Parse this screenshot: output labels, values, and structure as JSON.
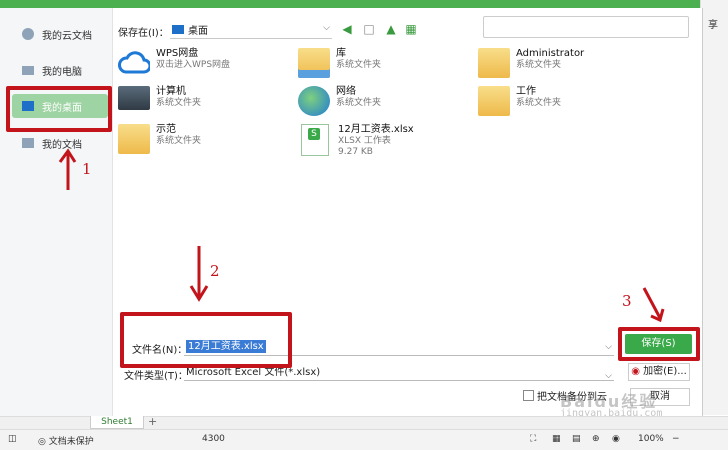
{
  "window": {
    "share_label": "享"
  },
  "sidebar": {
    "items": [
      {
        "label": "我的云文档",
        "icon": "cloud-doc-icon",
        "selected": false
      },
      {
        "label": "我的电脑",
        "icon": "computer-icon",
        "selected": false
      },
      {
        "label": "我的桌面",
        "icon": "desktop-icon",
        "selected": true
      },
      {
        "label": "我的文档",
        "icon": "document-icon",
        "selected": false
      }
    ]
  },
  "toolbar": {
    "save_in_label": "保存在(I)：",
    "location": "桌面",
    "icons": [
      "back-icon",
      "new-folder-icon",
      "up-folder-icon",
      "view-menu-icon"
    ]
  },
  "files": [
    {
      "name": "WPS网盘",
      "desc": "双击进入WPS网盘",
      "size": "",
      "icon": "cloud-icon"
    },
    {
      "name": "库",
      "desc": "系统文件夹",
      "size": "",
      "icon": "library-folder-icon"
    },
    {
      "name": "Administrator",
      "desc": "系统文件夹",
      "size": "",
      "icon": "folder-icon"
    },
    {
      "name": "计算机",
      "desc": "系统文件夹",
      "size": "",
      "icon": "computer-icon"
    },
    {
      "name": "网络",
      "desc": "系统文件夹",
      "size": "",
      "icon": "network-icon"
    },
    {
      "name": "工作",
      "desc": "系统文件夹",
      "size": "",
      "icon": "folder-icon"
    },
    {
      "name": "示范",
      "desc": "系统文件夹",
      "size": "",
      "icon": "folder-icon"
    },
    {
      "name": "12月工资表.xlsx",
      "desc": "XLSX 工作表",
      "size": "9.27 KB",
      "icon": "spreadsheet-icon"
    }
  ],
  "form": {
    "filename_label": "文件名(N)：",
    "filename_value": "12月工资表.xlsx",
    "filetype_label": "文件类型(T)：",
    "filetype_value": "Microsoft Excel 文件(*.xlsx)",
    "backup_label": "把文档备份到云",
    "save_button": "保存(S)",
    "encrypt_button": "加密(E)...",
    "cancel_button": "取消"
  },
  "annotations": [
    "1",
    "2",
    "3"
  ],
  "sheet_tab": "Sheet1",
  "status": {
    "protect": "文档未保护",
    "value": "4300",
    "zoom": "100%"
  },
  "watermark": {
    "text": "Baidu经验",
    "url": "jingyan.baidu.com"
  },
  "colors": {
    "accent": "#3aa94a",
    "highlight": "#c3141c",
    "selection": "#3a7bd5"
  }
}
